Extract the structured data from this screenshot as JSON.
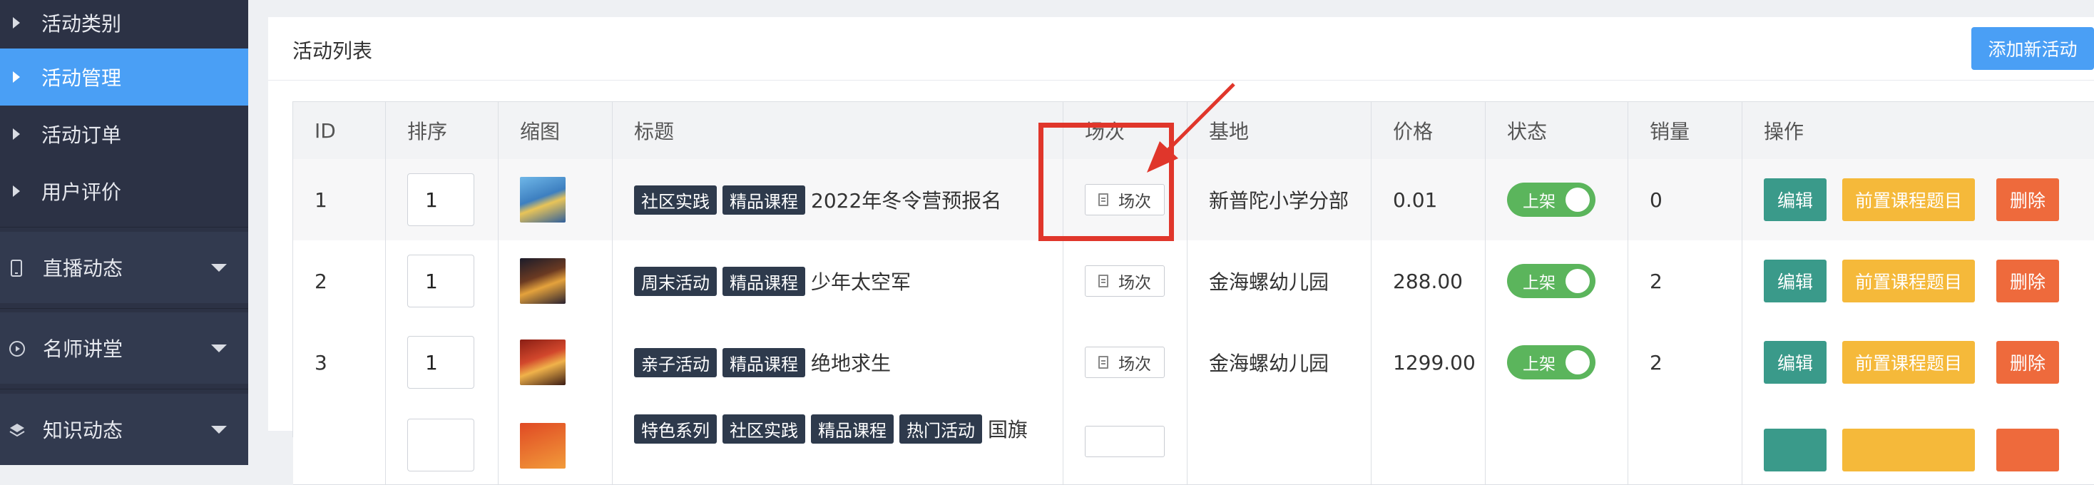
{
  "sidebar": {
    "items": [
      {
        "label": "活动类别",
        "active": false
      },
      {
        "label": "活动管理",
        "active": true
      },
      {
        "label": "活动订单",
        "active": false
      },
      {
        "label": "用户评价",
        "active": false
      }
    ],
    "groups": [
      {
        "label": "直播动态",
        "icon": "phone-icon"
      },
      {
        "label": "名师讲堂",
        "icon": "play-circle-icon"
      },
      {
        "label": "知识动态",
        "icon": "layers-icon"
      }
    ]
  },
  "panel": {
    "title": "活动列表",
    "add_button": "添加新活动"
  },
  "table": {
    "headers": [
      "ID",
      "排序",
      "缩图",
      "标题",
      "场次",
      "基地",
      "价格",
      "状态",
      "销量",
      "操作"
    ],
    "rows": [
      {
        "id": "1",
        "sort": "1",
        "tags": [
          "社区实践",
          "精品课程"
        ],
        "title": "2022年冬令营预报名",
        "session_btn": "场次",
        "base": "新普陀小学分部",
        "price": "0.01",
        "status": "上架",
        "sales": "0",
        "actions": [
          "编辑",
          "前置课程题目",
          "删除"
        ]
      },
      {
        "id": "2",
        "sort": "1",
        "tags": [
          "周末活动",
          "精品课程"
        ],
        "title": "少年太空军",
        "session_btn": "场次",
        "base": "金海螺幼儿园",
        "price": "288.00",
        "status": "上架",
        "sales": "2",
        "actions": [
          "编辑",
          "前置课程题目",
          "删除"
        ]
      },
      {
        "id": "3",
        "sort": "1",
        "tags": [
          "亲子活动",
          "精品课程"
        ],
        "title": "绝地求生",
        "session_btn": "场次",
        "base": "金海螺幼儿园",
        "price": "1299.00",
        "status": "上架",
        "sales": "2",
        "actions": [
          "编辑",
          "前置课程题目",
          "删除"
        ]
      },
      {
        "id": "",
        "sort": "",
        "tags": [
          "特色系列",
          "社区实践",
          "精品课程",
          "热门活动"
        ],
        "title": "国旗",
        "session_btn": "",
        "base": "",
        "price": "",
        "status": "",
        "sales": "",
        "actions": []
      }
    ]
  },
  "colors": {
    "sidebar_bg": "#2c3245",
    "active_item": "#4a9ff5",
    "add_button": "#4a9ff5",
    "edit_button": "#3a9a8a",
    "pre_button": "#f5b93a",
    "delete_button": "#ee6a3c",
    "toggle_on": "#5bb55c",
    "annotation_red": "#e0362b"
  }
}
